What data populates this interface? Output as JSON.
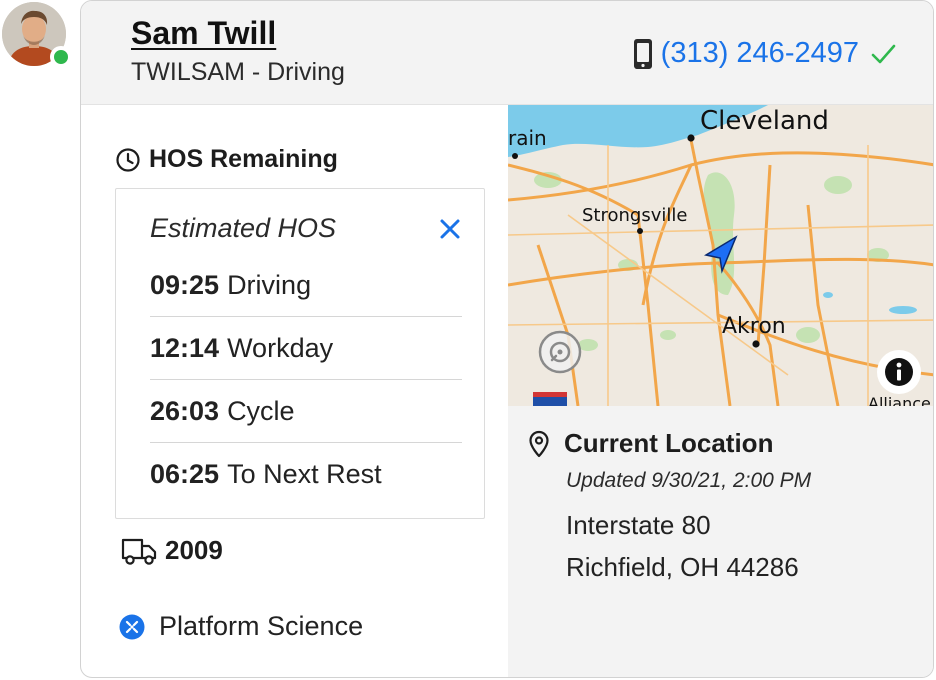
{
  "driver": {
    "name": "Sam Twill",
    "subtitle": "TWILSAM - Driving",
    "online": true
  },
  "phone": {
    "number": "(313) 246-2497",
    "verified": true
  },
  "hos": {
    "title": "HOS Remaining",
    "estimated_label": "Estimated HOS",
    "rows": [
      {
        "time": "09:25",
        "label": "Driving"
      },
      {
        "time": "12:14",
        "label": "Workday"
      },
      {
        "time": "26:03",
        "label": "Cycle"
      },
      {
        "time": "06:25",
        "label": "To Next Rest"
      }
    ]
  },
  "vehicle": {
    "number": "2009"
  },
  "provider": {
    "name": "Platform Science"
  },
  "map": {
    "labels": {
      "cleveland": "Cleveland",
      "lorain": "rain",
      "strongsville": "Strongsville",
      "akron": "Akron",
      "alliance": "Alliance"
    }
  },
  "location": {
    "title": "Current Location",
    "updated": "Updated 9/30/21, 2:00 PM",
    "address_line1": "Interstate 80",
    "address_line2": "Richfield, OH 44286"
  },
  "colors": {
    "accent": "#1a73e8",
    "online": "#2fb84d",
    "verified": "#2fb84d",
    "lake": "#7ccbea",
    "road": "#f2a64a"
  }
}
